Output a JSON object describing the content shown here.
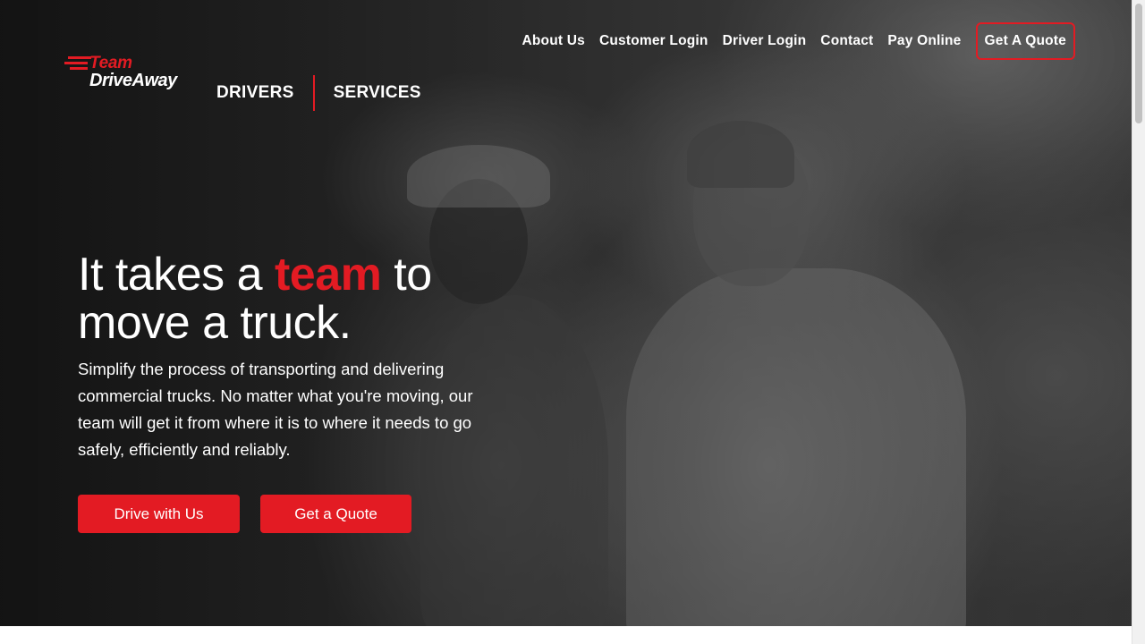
{
  "brand": {
    "line1": "Team",
    "line2": "DriveAway",
    "accent_color": "#e31b23"
  },
  "utility_nav": {
    "items": [
      "About Us",
      "Customer Login",
      "Driver Login",
      "Contact",
      "Pay Online"
    ],
    "cta": "Get A Quote"
  },
  "main_nav": {
    "items": [
      "DRIVERS",
      "SERVICES"
    ]
  },
  "hero": {
    "headline_before": "It takes a ",
    "headline_accent": "team",
    "headline_after": " to move a truck.",
    "subcopy": "Simplify the process of transporting and delivering commercial trucks. No matter what you're moving, our team will get it from where it is to where it needs to go safely, efficiently and reliably.",
    "buttons": {
      "drive": "Drive with Us",
      "quote": "Get a Quote"
    }
  }
}
